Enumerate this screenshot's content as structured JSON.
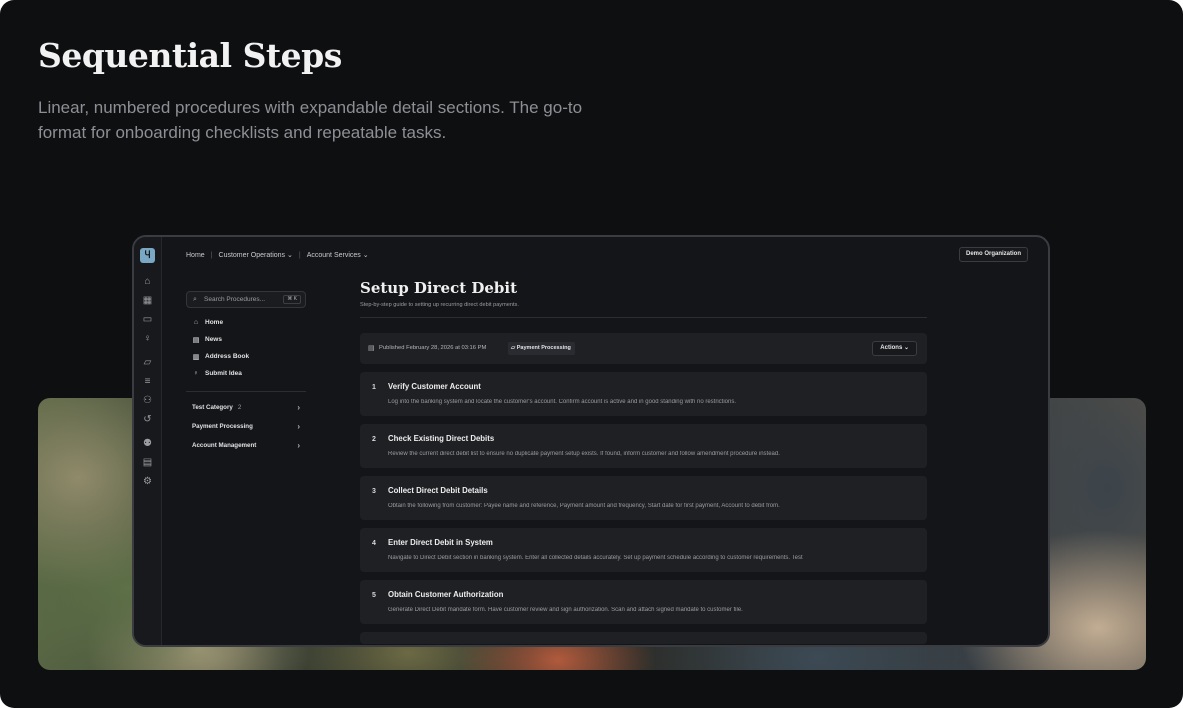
{
  "hero": {
    "title": "Sequential Steps",
    "subtitle": "Linear, numbered procedures with expandable detail sections. The go-to format for onboarding checklists and repeatable tasks."
  },
  "rail": {
    "logo_glyph": "Ⴗ",
    "icons": [
      "home-icon",
      "grid-icon",
      "inbox-icon",
      "lightbulb-icon",
      "folder-icon",
      "database-icon",
      "users-icon",
      "history-icon",
      "user-plus-icon",
      "calendar-icon",
      "gear-icon"
    ]
  },
  "topbar": {
    "breadcrumb": {
      "home": "Home",
      "customer_operations": "Customer Operations",
      "account_services": "Account Services"
    },
    "org_button": "Demo Organization"
  },
  "sidebar": {
    "search": {
      "placeholder": "Search Procedures...",
      "shortcut": "⌘ K"
    },
    "nav": [
      {
        "label": "Home",
        "icon": "home-icon"
      },
      {
        "label": "News",
        "icon": "news-icon"
      },
      {
        "label": "Address Book",
        "icon": "book-icon"
      },
      {
        "label": "Submit Idea",
        "icon": "lightbulb-icon"
      }
    ],
    "categories": [
      {
        "label": "Test Category",
        "count": "2"
      },
      {
        "label": "Payment Processing",
        "count": ""
      },
      {
        "label": "Account Management",
        "count": ""
      }
    ]
  },
  "document": {
    "title": "Setup Direct Debit",
    "subtitle": "Step-by-step guide to setting up recurring direct debit payments.",
    "published": "Published February 28, 2026 at 03:16 PM",
    "tag": "Payment Processing",
    "actions_label": "Actions"
  },
  "steps": [
    {
      "number": "1",
      "title": "Verify Customer Account",
      "description": "Log into the banking system and locate the customer's account. Confirm account is active and in good standing with no restrictions."
    },
    {
      "number": "2",
      "title": "Check Existing Direct Debits",
      "description": "Review the current direct debit list to ensure no duplicate payment setup exists. If found, inform customer and follow amendment procedure instead."
    },
    {
      "number": "3",
      "title": "Collect Direct Debit Details",
      "description": "Obtain the following from customer: Payee name and reference, Payment amount and frequency, Start date for first payment, Account to debit from."
    },
    {
      "number": "4",
      "title": "Enter Direct Debit in System",
      "description": "Navigate to Direct Debit section in banking system. Enter all collected details accurately. Set up payment schedule according to customer requirements. Test"
    },
    {
      "number": "5",
      "title": "Obtain Customer Authorization",
      "description": "Generate Direct Debit mandate form. Have customer review and sign authorization. Scan and attach signed mandate to customer file."
    }
  ],
  "colors": {
    "page_bg": "#0e0f11",
    "window_bg": "#141518",
    "card_bg": "#1f2024",
    "accent": "#7aa8c4"
  }
}
